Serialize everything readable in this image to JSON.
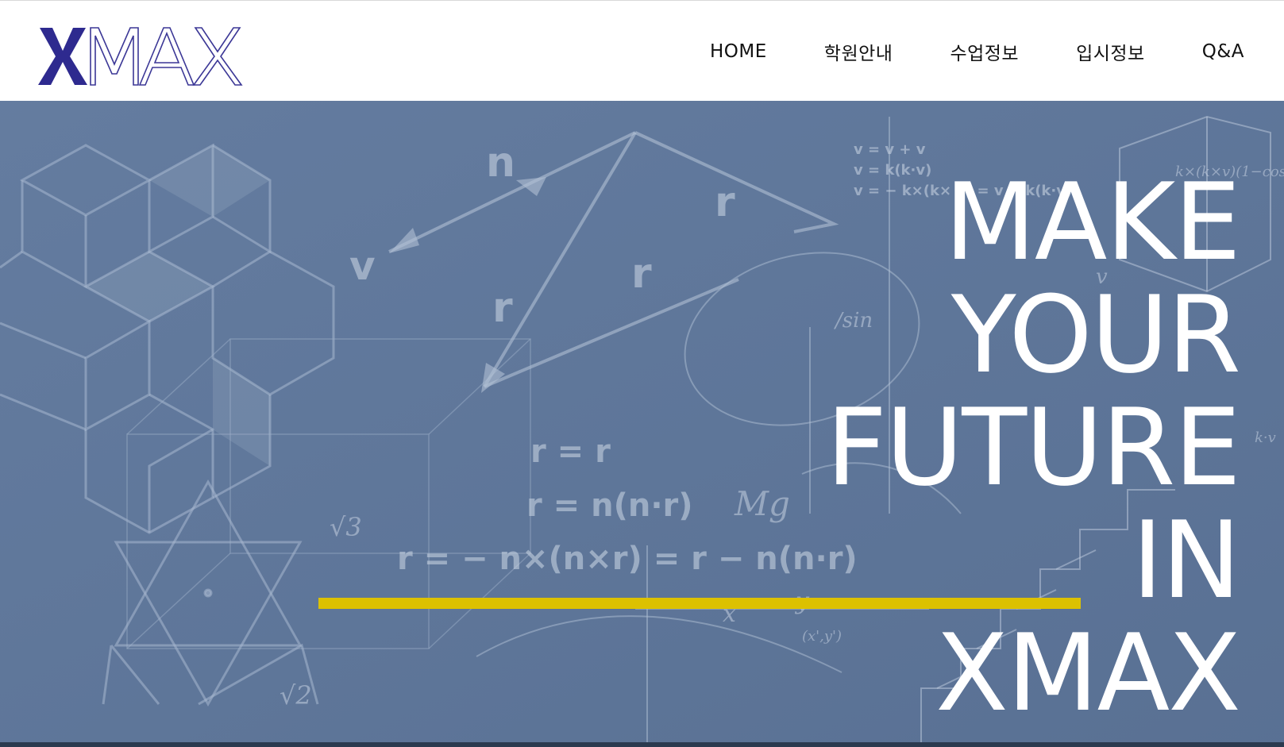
{
  "brand": {
    "logo_text": "XMAX",
    "logo_x_color": "#2e2a8f",
    "logo_outline_color": "#3b3796"
  },
  "nav": {
    "items": [
      {
        "label": "HOME"
      },
      {
        "label": "학원안내"
      },
      {
        "label": "수업정보"
      },
      {
        "label": "입시정보"
      },
      {
        "label": "Q&A"
      }
    ]
  },
  "hero": {
    "headline_lines": [
      "MAKE",
      "YOUR",
      "FUTURE",
      "IN",
      "XMAX"
    ],
    "background_color": "#5e7699",
    "accent_line_color": "#dcc100",
    "chalk_text": {
      "n": "n",
      "v": "v",
      "r": "r",
      "r_par": "r",
      "r_perp": "r",
      "eq1": "r = r",
      "eq2": "r = n(n·r)",
      "eq3": "r = − n×(n×r) = r − n(n·r)",
      "mg": "Mg",
      "sqrt3": "√3",
      "sqrt2": "√2",
      "sin": "/sin",
      "v_eq1": "v = v + v",
      "v_eq2": "v = k(k·v)",
      "v_eq3": "v = − k×(k× v) = v − k(k·v)",
      "vrot": "v",
      "x": "x",
      "y": "y",
      "xy": "(x',y')",
      "kxv": "k×(k×v)(1−cos",
      "kv": "k·v"
    }
  }
}
